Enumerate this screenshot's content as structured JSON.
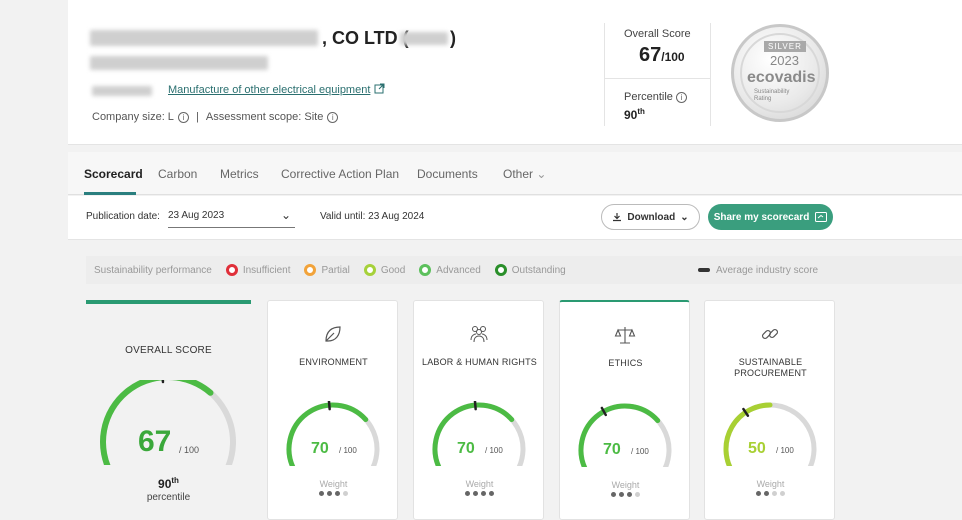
{
  "company": {
    "name_visible": ", CO LTD (",
    "name_suffix": ")",
    "industry": "Manufacture of other electrical equipment",
    "size_label": "Company size: L",
    "scope_label": "Assessment scope: Site"
  },
  "summary": {
    "overall_label": "Overall Score",
    "overall_value": "67",
    "overall_denominator": "/100",
    "percentile_label": "Percentile",
    "percentile_value": "90",
    "percentile_suffix": "th"
  },
  "badge": {
    "tier": "SILVER",
    "year": "2023",
    "brand": "ecovadis",
    "subtitle_1": "Sustainability",
    "subtitle_2": "Rating"
  },
  "tabs": [
    {
      "label": "Scorecard",
      "active": true
    },
    {
      "label": "Carbon"
    },
    {
      "label": "Metrics"
    },
    {
      "label": "Corrective Action Plan"
    },
    {
      "label": "Documents"
    },
    {
      "label": "Other"
    }
  ],
  "publication": {
    "label": "Publication date:",
    "selected_date": "23 Aug 2023",
    "valid_until": "Valid until: 23 Aug 2024",
    "download_label": "Download",
    "share_label": "Share my scorecard"
  },
  "legend": {
    "title": "Sustainability performance",
    "items": [
      {
        "label": "Insufficient",
        "color": "#e0303a"
      },
      {
        "label": "Partial",
        "color": "#f2a33a"
      },
      {
        "label": "Good",
        "color": "#a6d13a"
      },
      {
        "label": "Advanced",
        "color": "#5cc05c"
      },
      {
        "label": "Outstanding",
        "color": "#2a8f2a"
      }
    ],
    "average_label": "Average industry score"
  },
  "overall_card": {
    "title": "OVERALL SCORE",
    "score": "67",
    "denominator": "/ 100",
    "score_fraction": 0.67,
    "industry_avg_fraction": 0.48,
    "percentile": "90",
    "percentile_suffix": "th",
    "percentile_label": "percentile",
    "color": "#4cbb44"
  },
  "theme_cards": [
    {
      "title": "ENVIRONMENT",
      "score": "70",
      "denominator": "/ 100",
      "score_fraction": 0.7,
      "avg_fraction": 0.48,
      "color": "#4cbb44",
      "weight_label": "Weight",
      "weight_level": 3,
      "icon": "leaf-icon"
    },
    {
      "title": "LABOR & HUMAN RIGHTS",
      "score": "70",
      "denominator": "/ 100",
      "score_fraction": 0.7,
      "avg_fraction": 0.48,
      "color": "#4cbb44",
      "weight_label": "Weight",
      "weight_level": 4,
      "icon": "people-icon"
    },
    {
      "title": "ETHICS",
      "score": "70",
      "denominator": "/ 100",
      "score_fraction": 0.7,
      "avg_fraction": 0.38,
      "color": "#4cbb44",
      "weight_label": "Weight",
      "weight_level": 3,
      "icon": "scales-icon"
    },
    {
      "title": "SUSTAINABLE PROCUREMENT",
      "score": "50",
      "denominator": "/ 100",
      "score_fraction": 0.5,
      "avg_fraction": 0.36,
      "color": "#a8d033",
      "weight_label": "Weight",
      "weight_level": 2,
      "icon": "chain-link-icon"
    }
  ]
}
